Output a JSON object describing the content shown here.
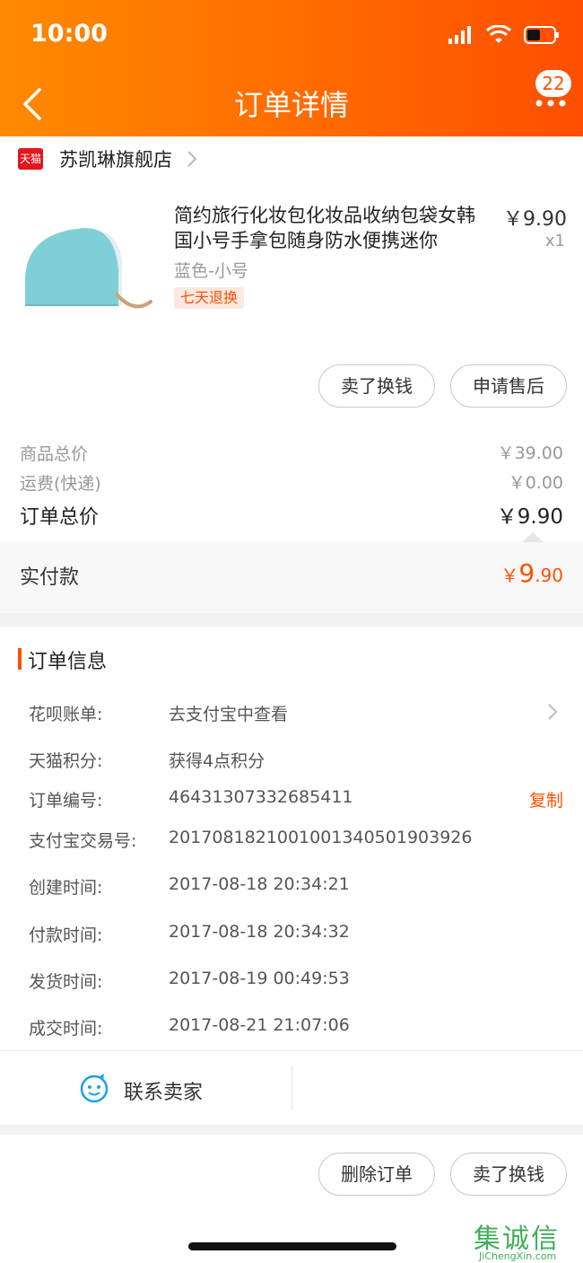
{
  "status_bar": {
    "time": "10:00"
  },
  "header": {
    "title": "订单详情",
    "badge_count": "22"
  },
  "shop": {
    "logo_text": "天猫",
    "name": "苏凯琳旗舰店"
  },
  "product": {
    "title": "简约旅行化妆包化妆品收纳包袋女韩国小号手拿包随身防水便携迷你",
    "price": "￥9.90",
    "quantity": "x1",
    "spec": "蓝色-小号",
    "tag": "七天退换",
    "image_color": "#7fd0d6"
  },
  "actions": {
    "sell_button": "卖了换钱",
    "after_sale_button": "申请售后"
  },
  "summary": {
    "goods_total_label": "商品总价",
    "goods_total_value": "￥39.00",
    "shipping_label": "运费(快递)",
    "shipping_value": "￥0.00",
    "order_total_label": "订单总价",
    "order_total_value": "￥9.90",
    "paid_label": "实付款",
    "paid_currency": "￥",
    "paid_integer": "9",
    "paid_decimal": ".90"
  },
  "order_info": {
    "title": "订单信息",
    "rows": [
      {
        "label": "花呗账单:",
        "value": "去支付宝中查看"
      },
      {
        "label": "天猫积分:",
        "value": "获得4点积分"
      },
      {
        "label": "订单编号:",
        "value": "46431307332685411"
      },
      {
        "label": "支付宝交易号:",
        "value": "2017081821001001340501903926"
      },
      {
        "label": "创建时间:",
        "value": "2017-08-18 20:34:21"
      },
      {
        "label": "付款时间:",
        "value": "2017-08-18 20:34:32"
      },
      {
        "label": "发货时间:",
        "value": "2017-08-19 00:49:53"
      },
      {
        "label": "成交时间:",
        "value": "2017-08-21 21:07:06"
      }
    ],
    "copy_label": "复制"
  },
  "contact": {
    "label": "联系卖家"
  },
  "bottom_actions": {
    "delete_button": "删除订单",
    "sell_button": "卖了换钱"
  },
  "watermark": {
    "text": "集诚信",
    "sub": "JiChengXin.com"
  },
  "colors": {
    "accent": "#ff5000",
    "header_start": "#ff8a00",
    "header_end": "#ff4e00"
  }
}
